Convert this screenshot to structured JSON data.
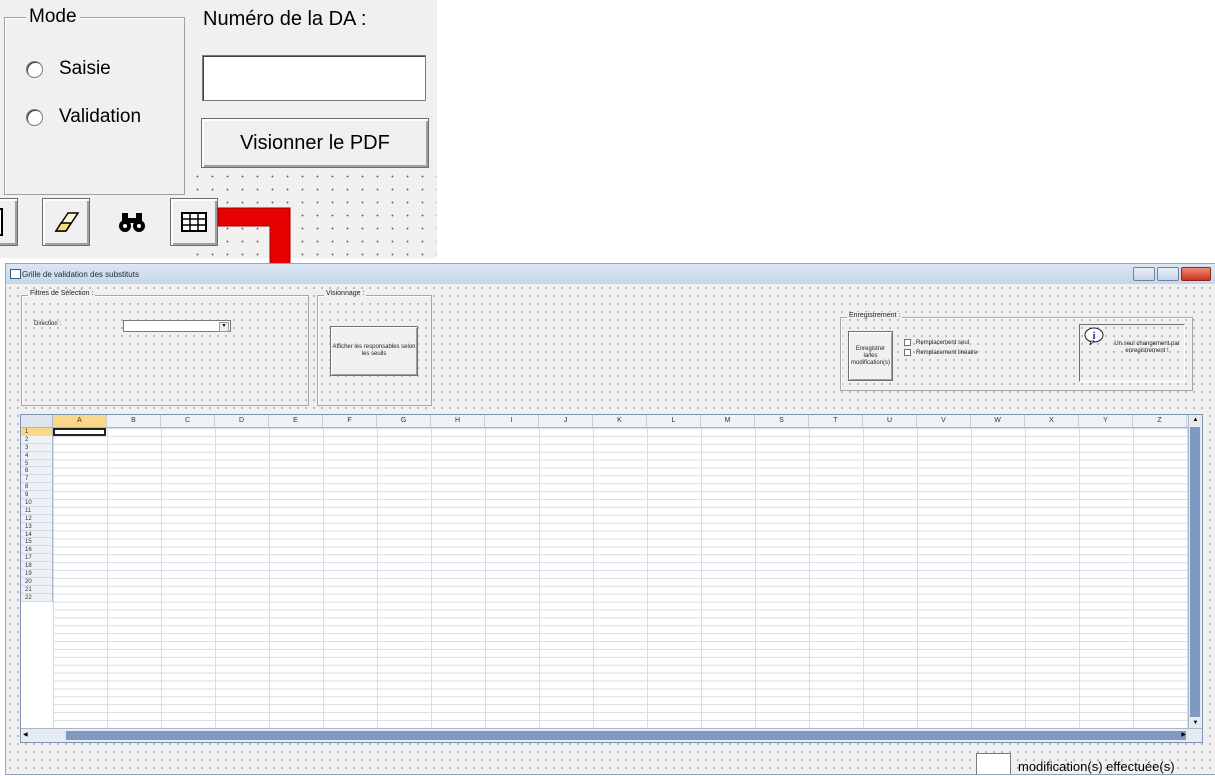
{
  "top_form": {
    "mode_group_title": "Mode",
    "mode_options": [
      {
        "label": "Saisie",
        "selected": false
      },
      {
        "label": "Validation",
        "selected": false
      }
    ],
    "da_label": "Numéro de la DA :",
    "da_value": "",
    "pdf_button": "Visionner le PDF",
    "toolbar_icons": [
      "document-icon",
      "eraser-icon",
      "binoculars-icon",
      "grid-icon"
    ]
  },
  "window": {
    "title": "Grille de validation des substituts",
    "filters": {
      "title": "Filtres de Sélection :",
      "direction_label": "Direction :",
      "direction_value": ""
    },
    "visionnage": {
      "title": "Visionnage :",
      "button": "Afficher les responsables selon les seuils"
    },
    "enregistrement": {
      "title": "Enregistrement :",
      "save_button": "Enregistrer la/les modification(s)",
      "checkbox_1": "Remplacement seul",
      "checkbox_2": "Remplacement linéaire",
      "info_text": "Un seul changement par enregistrement !"
    },
    "sheet": {
      "columns": [
        "A",
        "B",
        "C",
        "D",
        "E",
        "F",
        "G",
        "H",
        "I",
        "J",
        "K",
        "L",
        "M",
        "S",
        "T",
        "U",
        "V",
        "W",
        "X",
        "Y",
        "Z"
      ],
      "rows": [
        "1",
        "2",
        "3",
        "4",
        "5",
        "6",
        "7",
        "8",
        "9",
        "10",
        "11",
        "12",
        "13",
        "14",
        "15",
        "16",
        "17",
        "18",
        "19",
        "20",
        "21",
        "22"
      ],
      "active_cell": "A1"
    },
    "footer": {
      "count_value": "",
      "count_label": "modification(s) effectuée(s)"
    }
  },
  "colors": {
    "arrow": "#e60000",
    "selection": "#f9d88c",
    "scrollbar": "#7e9ac2"
  }
}
